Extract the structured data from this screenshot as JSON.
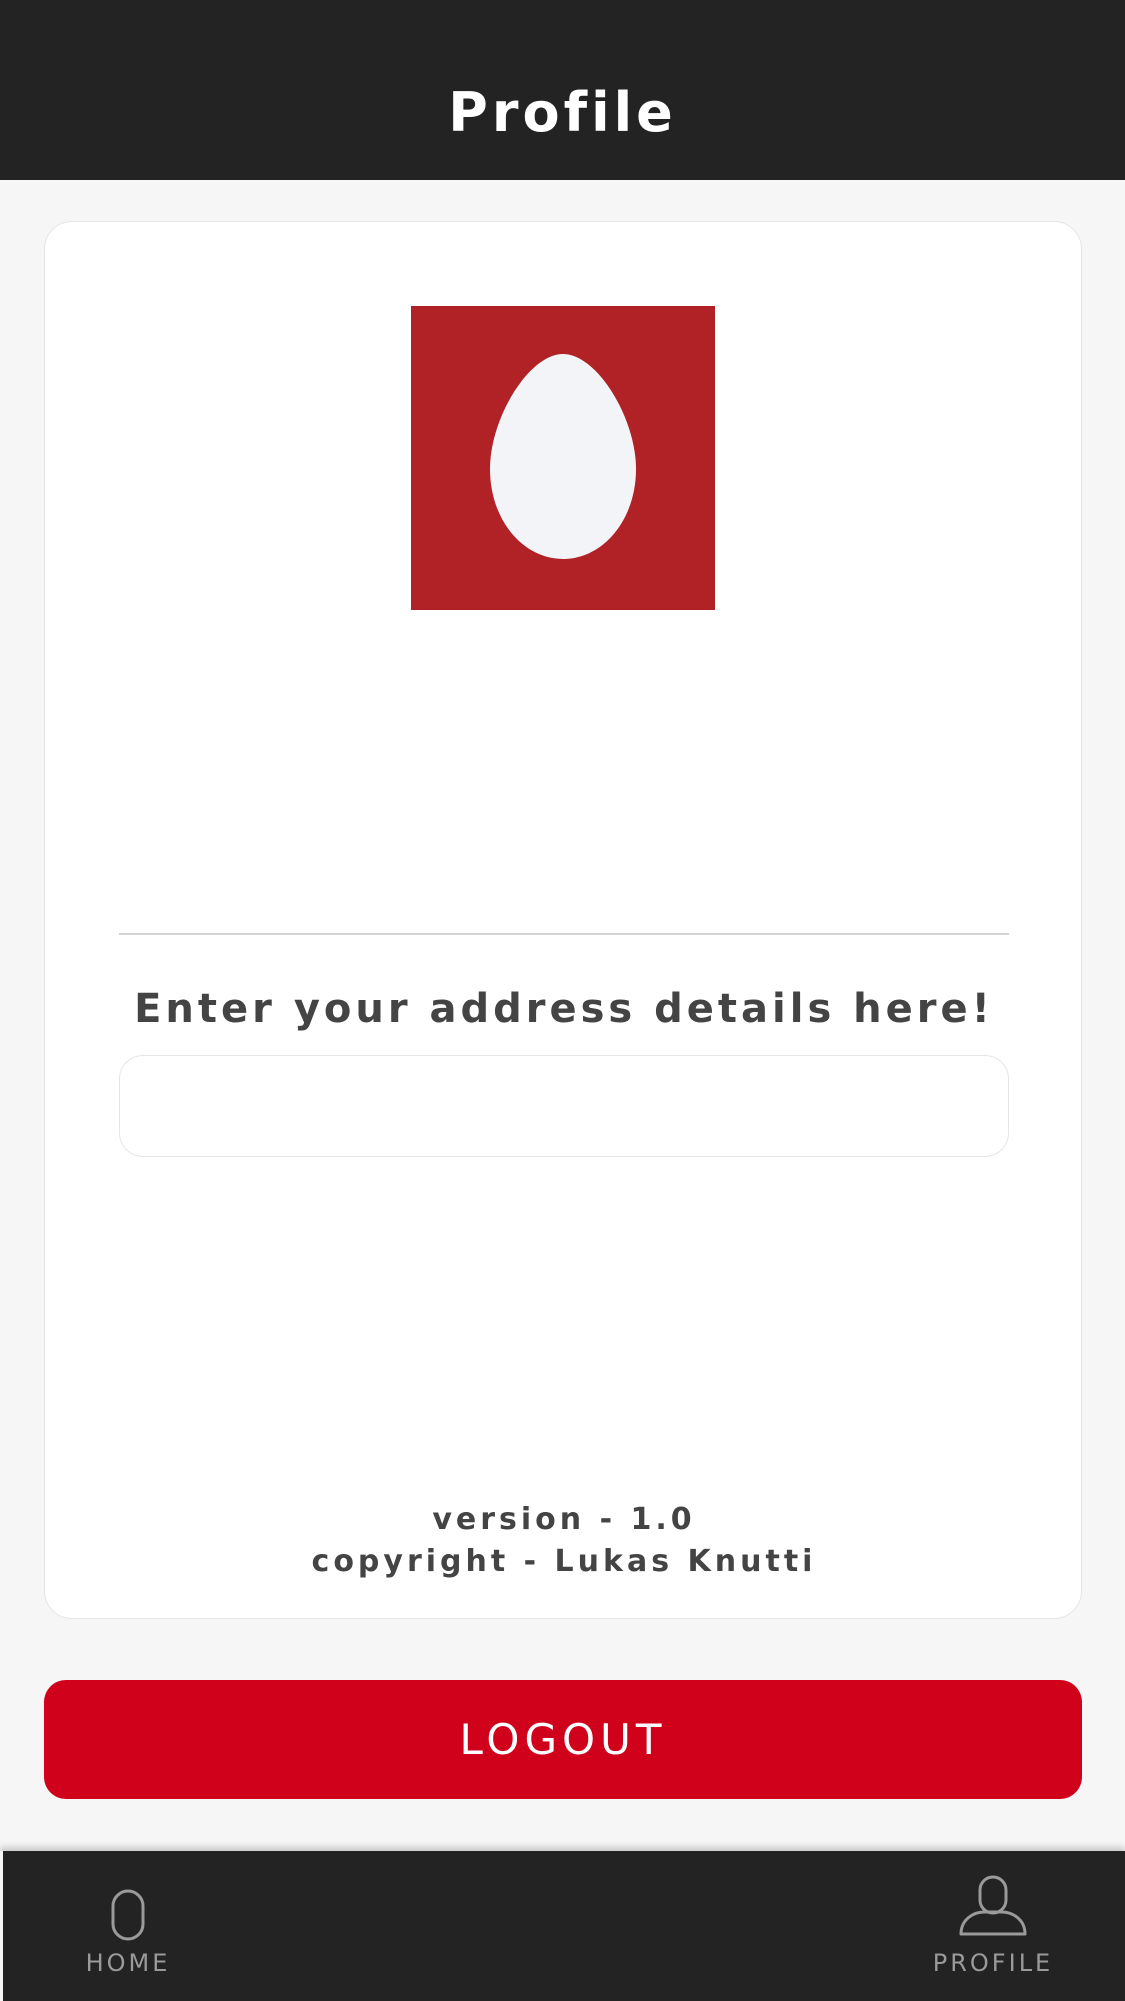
{
  "header": {
    "title": "Profile"
  },
  "profile": {
    "avatar_icon": "egg-avatar-icon",
    "address_label": "Enter your address details here!",
    "address_value": "",
    "address_placeholder": "",
    "version_text": "version - 1.0",
    "copyright_text": "copyright - Lukas Knutti"
  },
  "actions": {
    "logout_label": "LOGOUT"
  },
  "tabbar": {
    "items": [
      {
        "label": "HOME",
        "icon": "home-capsule-icon"
      },
      {
        "label": "PROFILE",
        "icon": "person-icon"
      }
    ]
  },
  "colors": {
    "header_bg": "#232323",
    "page_bg": "#f6f6f6",
    "avatar_bg": "#b02226",
    "egg_fill": "#f2f4f7",
    "logout_bg": "#d0011b",
    "text_dark": "#444444",
    "tab_label": "#9a9a9a"
  }
}
